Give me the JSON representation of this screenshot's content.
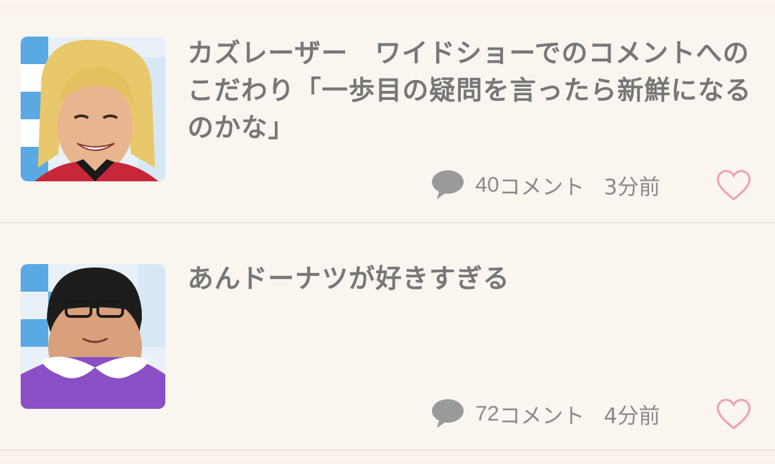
{
  "topics": [
    {
      "title": "カズレーザー　ワイドショーでのコメントへのこだわり「一歩目の疑問を言ったら新鮮になるのかな」",
      "comment_count": "40",
      "comment_suffix": "コメント",
      "time": "3分前"
    },
    {
      "title": "あんドーナツが好きすぎる",
      "comment_count": "72",
      "comment_suffix": "コメント",
      "time": "4分前"
    }
  ],
  "icons": {
    "comment": "speech-bubble-icon",
    "favorite": "heart-outline-icon"
  },
  "colors": {
    "background": "#faf5ee",
    "text": "#777777",
    "meta_text": "#8a8a8a",
    "heart": "#f0a0ac",
    "comment_icon": "#9a9a9a"
  }
}
